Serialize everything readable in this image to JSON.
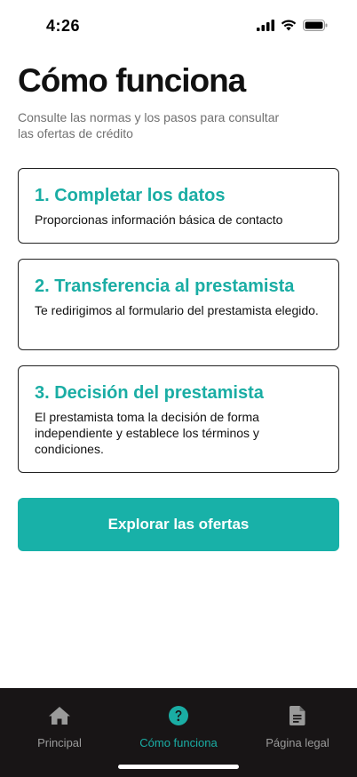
{
  "status_bar": {
    "time": "4:26",
    "icons": [
      "signal-icon",
      "wifi-icon",
      "battery-icon"
    ]
  },
  "header": {
    "title": "Cómo funciona",
    "subtitle": "Consulte las normas y los pasos para consultar las ofertas de crédito"
  },
  "steps": [
    {
      "title": "1. Completar los datos",
      "description": "Proporcionas información básica de contacto"
    },
    {
      "title": "2. Transferencia al prestamista",
      "description": "Te redirigimos al formulario del prestamista elegido."
    },
    {
      "title": "3. Decisión del prestamista",
      "description": "El prestamista toma la decisión de forma independiente y establece los términos y condiciones."
    }
  ],
  "cta": {
    "label": "Explorar las ofertas"
  },
  "bottom_nav": {
    "items": [
      {
        "label": "Principal",
        "icon": "home-icon",
        "active": false
      },
      {
        "label": "Cómo funciona",
        "icon": "question-circle-icon",
        "active": true
      },
      {
        "label": "Página legal",
        "icon": "document-icon",
        "active": false
      }
    ]
  },
  "colors": {
    "accent": "#1aada4",
    "nav_background": "#181516",
    "nav_inactive": "#9a9a9a"
  }
}
